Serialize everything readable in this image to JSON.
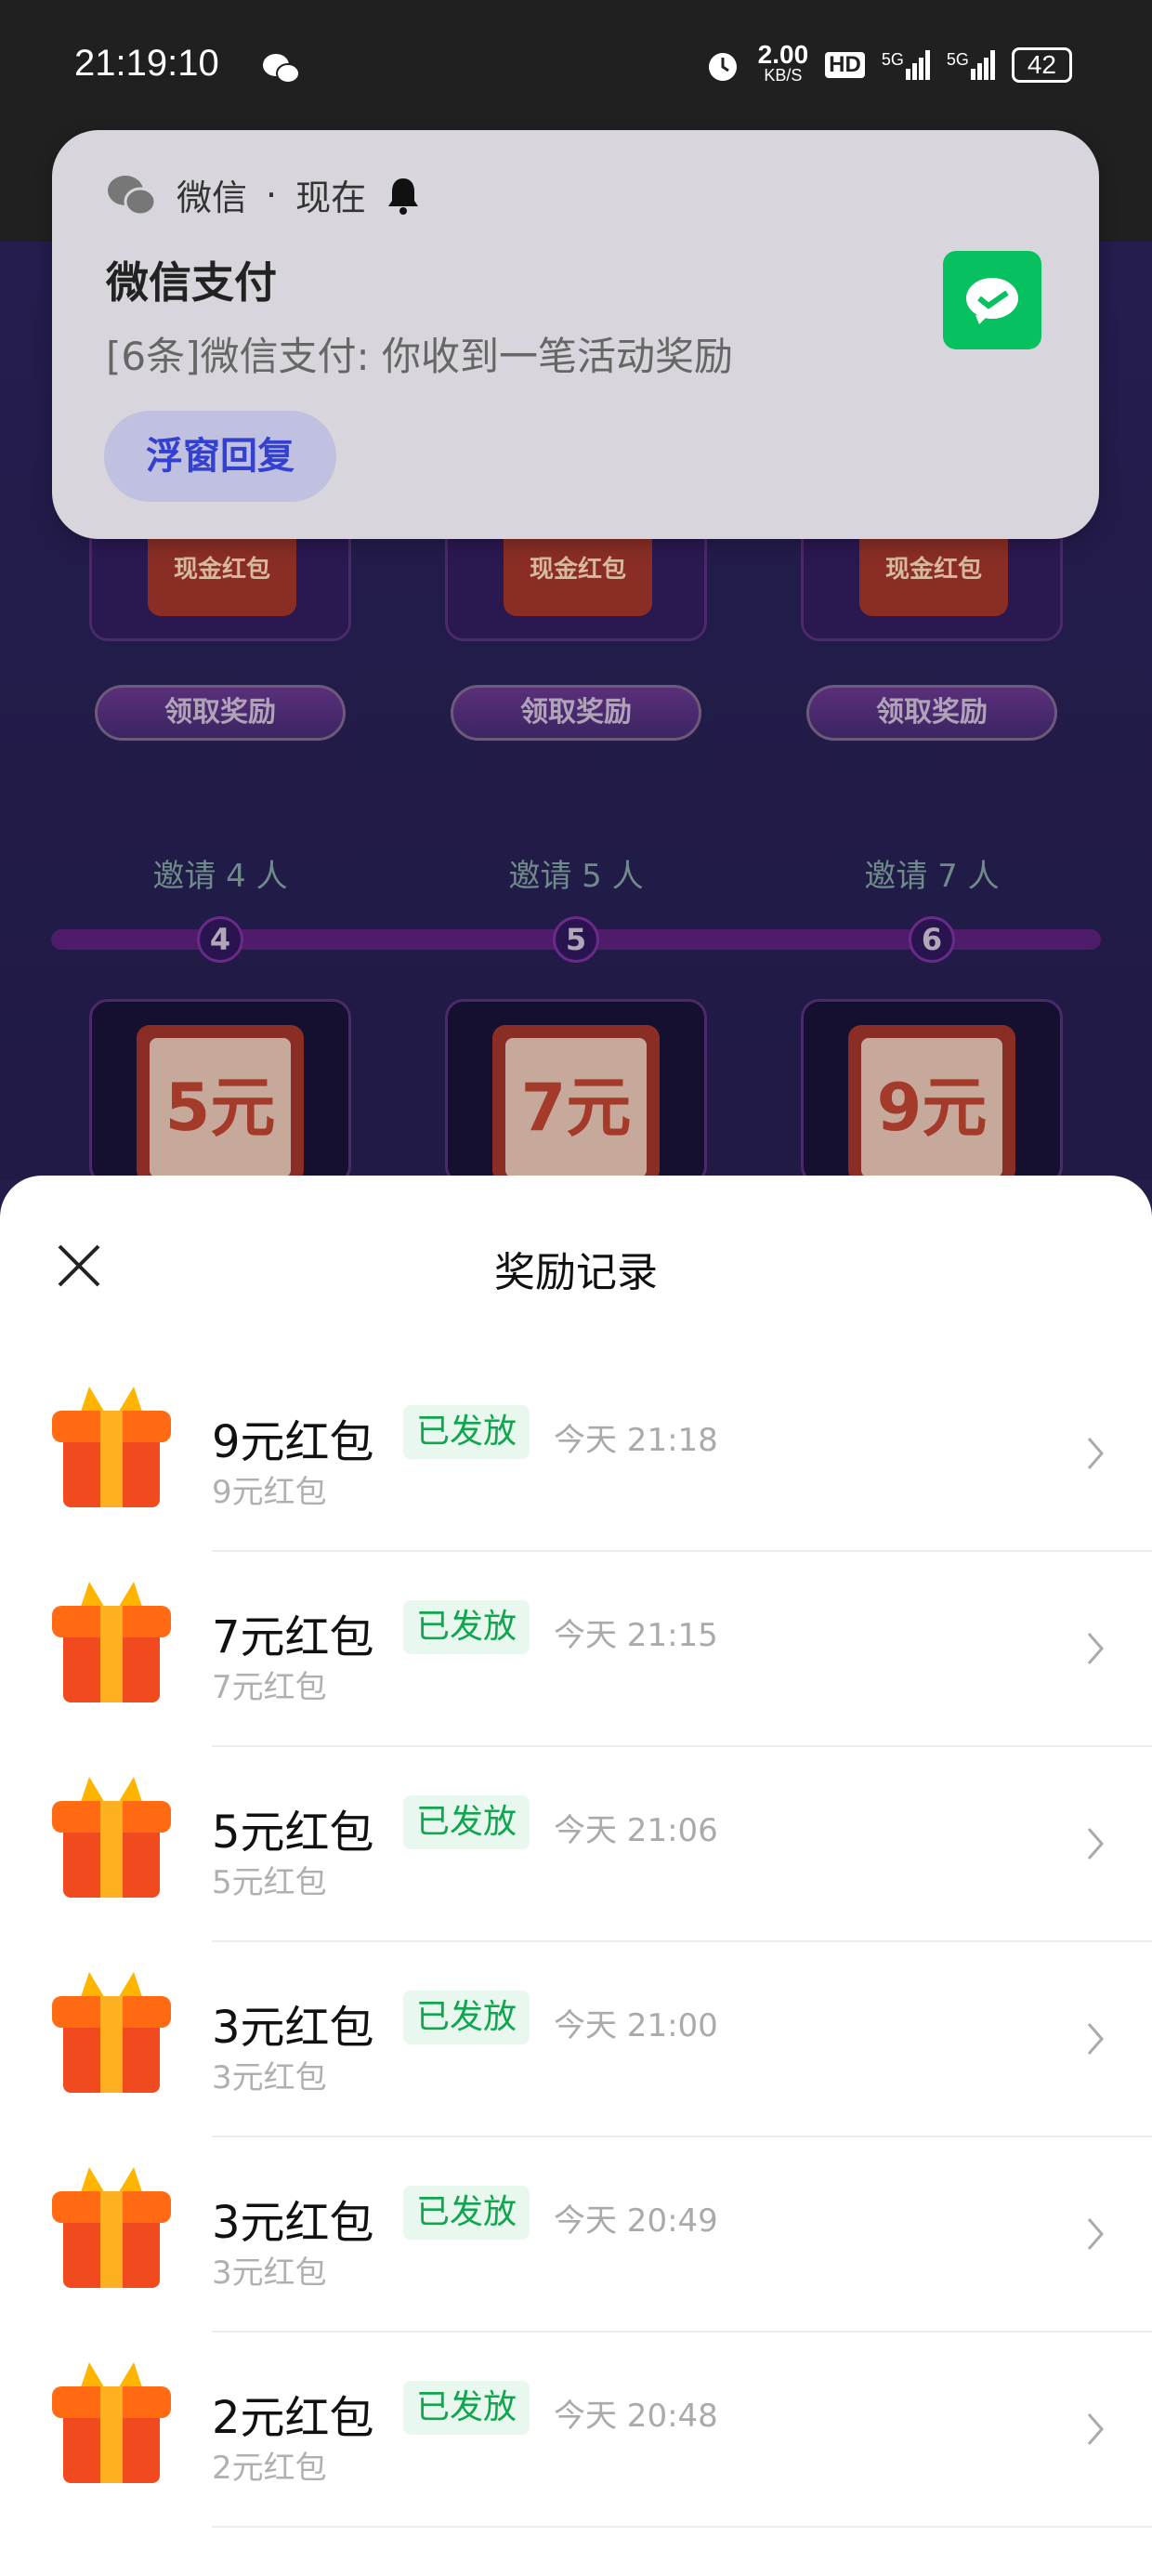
{
  "status_bar": {
    "time": "21:19:10",
    "net_speed": "2.00",
    "net_unit": "KB/S",
    "hd": "HD",
    "signal1": "5G",
    "signal2": "5G",
    "battery": "42"
  },
  "background": {
    "cards": [
      {
        "label": "现金红包",
        "button": "领取奖励"
      },
      {
        "label": "现金红包",
        "button": "领取奖励"
      },
      {
        "label": "现金红包",
        "button": "领取奖励"
      }
    ],
    "milestones": [
      {
        "invite": "邀请 4 人",
        "step": "4",
        "amount": "5元"
      },
      {
        "invite": "邀请 5 人",
        "step": "5",
        "amount": "7元"
      },
      {
        "invite": "邀请 7 人",
        "step": "6",
        "amount": "9元"
      }
    ]
  },
  "notification": {
    "app": "微信",
    "separator": "·",
    "when": "现在",
    "title": "微信支付",
    "body": "[6条]微信支付: 你收到一笔活动奖励",
    "action": "浮窗回复",
    "accent": "#07c160"
  },
  "sheet": {
    "title": "奖励记录",
    "items": [
      {
        "title": "9元红包",
        "status": "已发放",
        "time": "今天 21:18",
        "subtitle": "9元红包"
      },
      {
        "title": "7元红包",
        "status": "已发放",
        "time": "今天 21:15",
        "subtitle": "7元红包"
      },
      {
        "title": "5元红包",
        "status": "已发放",
        "time": "今天 21:06",
        "subtitle": "5元红包"
      },
      {
        "title": "3元红包",
        "status": "已发放",
        "time": "今天 21:00",
        "subtitle": "3元红包"
      },
      {
        "title": "3元红包",
        "status": "已发放",
        "time": "今天 20:49",
        "subtitle": "3元红包"
      },
      {
        "title": "2元红包",
        "status": "已发放",
        "time": "今天 20:48",
        "subtitle": "2元红包"
      }
    ]
  }
}
